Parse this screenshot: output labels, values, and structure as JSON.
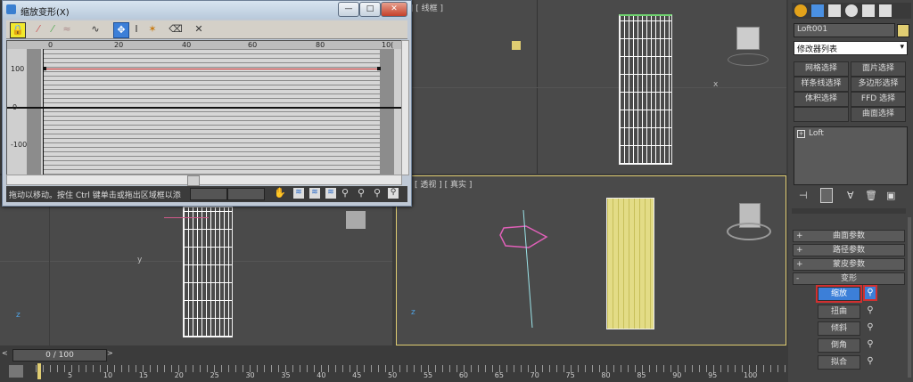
{
  "dialog": {
    "title": "缩放变形(X)",
    "minimize": "—",
    "maximize": "□",
    "close": "✕",
    "ruler_labels": [
      "0",
      "20",
      "40",
      "60",
      "80",
      "10("
    ],
    "y_labels": [
      "100",
      "0",
      "-100"
    ],
    "status_text": "拖动以移动。按住 Ctrl 键单击或拖出区域框以添"
  },
  "viewports": {
    "top_right_label": "前 ] [ 线框 ]",
    "perspective_label": "[ 透视 ] [ 真实 ]",
    "axis_x": "x",
    "axis_y": "y",
    "axis_z": "z"
  },
  "panel": {
    "object_name": "Loft001",
    "modifier_list": "修改器列表",
    "selection_buttons": [
      "网格选择",
      "面片选择",
      "样条线选择",
      "多边形选择",
      "体积选择",
      "FFD 选择",
      "曲面选择"
    ],
    "stack_item": "Loft",
    "rollouts": [
      "曲面参数",
      "路径参数",
      "蒙皮参数"
    ],
    "deform_rollout": "变形",
    "deform_buttons": [
      "缩放",
      "扭曲",
      "倾斜",
      "倒角",
      "拟合"
    ],
    "plus": "+",
    "minus": "-"
  },
  "timeline": {
    "frame": "0 / 100",
    "ticks": [
      "5",
      "10",
      "15",
      "20",
      "25",
      "30",
      "35",
      "40",
      "45",
      "50",
      "55",
      "60",
      "65",
      "70",
      "75",
      "80",
      "85",
      "90",
      "95",
      "100"
    ]
  },
  "colors": {
    "accent_blue": "#3c7fd8",
    "highlight_red": "#d03030",
    "yellow_mesh": "#e3dc86"
  }
}
